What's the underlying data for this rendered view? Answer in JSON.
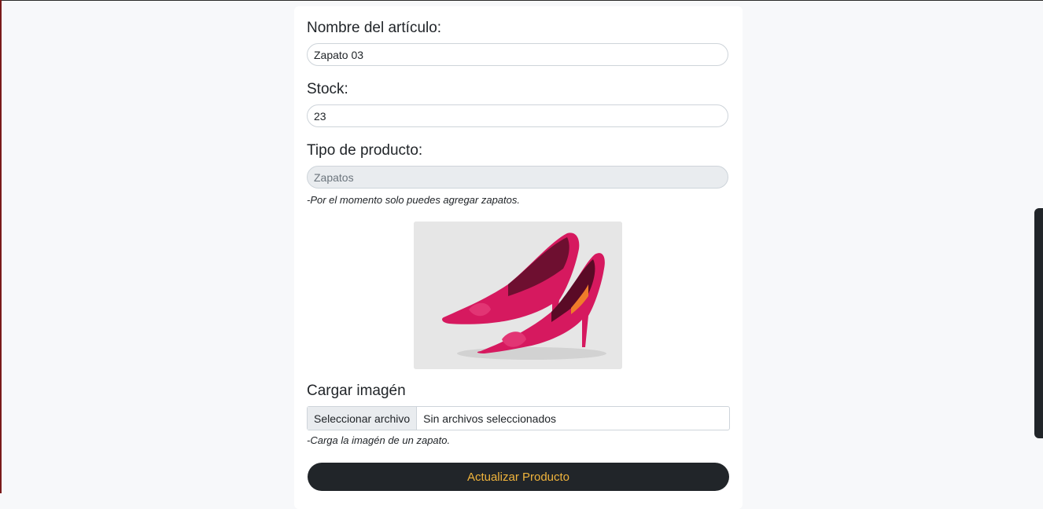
{
  "form": {
    "name_label": "Nombre del artículo:",
    "name_value": "Zapato 03",
    "stock_label": "Stock:",
    "stock_value": "23",
    "type_label": "Tipo de producto:",
    "type_value": "Zapatos",
    "type_hint": "-Por el momento solo puedes agregar zapatos.",
    "image_label": "Cargar imagén",
    "file_button_label": "Seleccionar archivo",
    "file_status": "Sin archivos seleccionados",
    "image_hint": "-Carga la imagén de un zapato.",
    "submit_label": "Actualizar Producto"
  },
  "colors": {
    "submit_bg": "#212529",
    "submit_text": "#f0b43c",
    "shoe": "#d6195f"
  }
}
